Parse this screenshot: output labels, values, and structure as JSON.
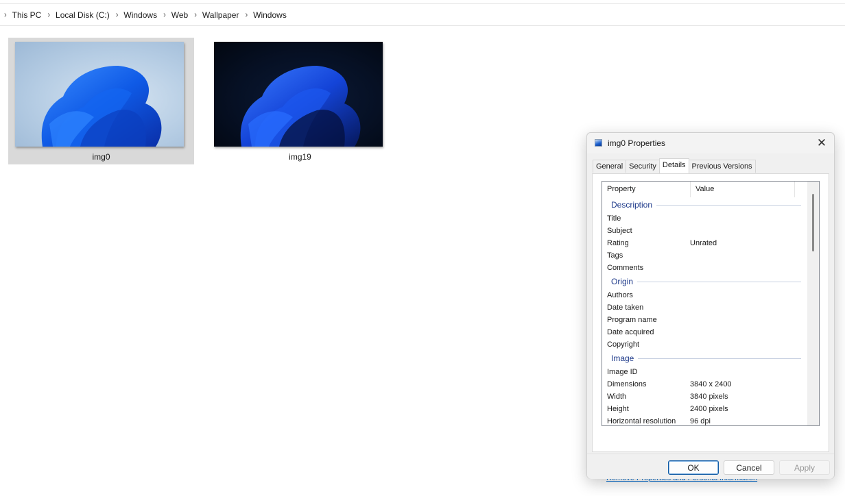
{
  "breadcrumb": {
    "items": [
      "This PC",
      "Local Disk (C:)",
      "Windows",
      "Web",
      "Wallpaper",
      "Windows"
    ]
  },
  "files": [
    {
      "name": "img0",
      "selected": true,
      "theme": "light"
    },
    {
      "name": "img19",
      "selected": false,
      "theme": "dark"
    }
  ],
  "dialog": {
    "title": "img0 Properties",
    "close_icon": "close-icon",
    "tabs": [
      {
        "label": "General",
        "active": false
      },
      {
        "label": "Security",
        "active": false
      },
      {
        "label": "Details",
        "active": true
      },
      {
        "label": "Previous Versions",
        "active": false
      }
    ],
    "columns": {
      "property": "Property",
      "value": "Value"
    },
    "groups": [
      {
        "label": "Description",
        "rows": [
          {
            "property": "Title",
            "value": ""
          },
          {
            "property": "Subject",
            "value": ""
          },
          {
            "property": "Rating",
            "value": "Unrated"
          },
          {
            "property": "Tags",
            "value": ""
          },
          {
            "property": "Comments",
            "value": ""
          }
        ]
      },
      {
        "label": "Origin",
        "rows": [
          {
            "property": "Authors",
            "value": ""
          },
          {
            "property": "Date taken",
            "value": ""
          },
          {
            "property": "Program name",
            "value": ""
          },
          {
            "property": "Date acquired",
            "value": ""
          },
          {
            "property": "Copyright",
            "value": ""
          }
        ]
      },
      {
        "label": "Image",
        "rows": [
          {
            "property": "Image ID",
            "value": ""
          },
          {
            "property": "Dimensions",
            "value": "3840 x 2400"
          },
          {
            "property": "Width",
            "value": "3840 pixels"
          },
          {
            "property": "Height",
            "value": "2400 pixels"
          },
          {
            "property": "Horizontal resolution",
            "value": "96 dpi"
          }
        ]
      }
    ],
    "remove_link": "Remove Properties and Personal Information",
    "buttons": {
      "ok": "OK",
      "cancel": "Cancel",
      "apply": "Apply"
    },
    "apply_enabled": false
  },
  "colors": {
    "group_label": "#1e3a8a",
    "link": "#0b63b6",
    "selection": "#d9d9d9",
    "ok_border": "#0f5aa5"
  }
}
